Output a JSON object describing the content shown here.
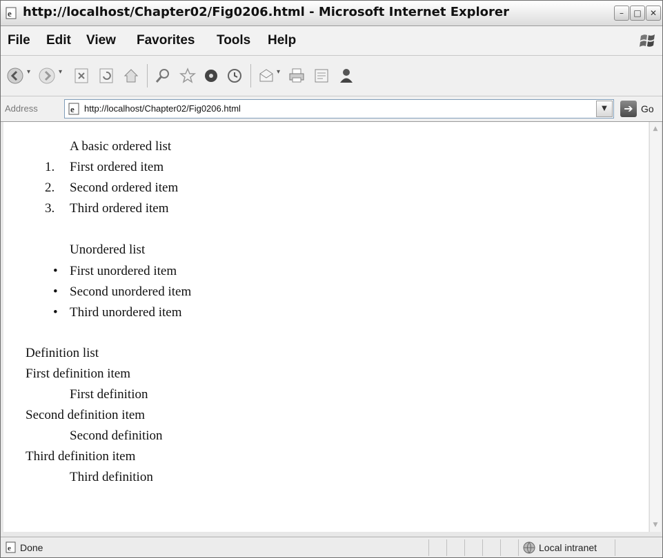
{
  "window": {
    "title": "http://localhost/Chapter02/Fig0206.html - Microsoft Internet Explorer"
  },
  "menu": {
    "items": [
      "File",
      "Edit",
      "View",
      "Favorites",
      "Tools",
      "Help"
    ]
  },
  "toolbar": {
    "icons": [
      "back-icon",
      "forward-icon",
      "stop-icon",
      "refresh-icon",
      "home-icon",
      "search-icon",
      "favorites-icon",
      "media-icon",
      "history-icon",
      "mail-icon",
      "print-icon",
      "edit-icon",
      "messenger-icon"
    ]
  },
  "address": {
    "label": "Address",
    "url": "http://localhost/Chapter02/Fig0206.html",
    "go_label": "Go"
  },
  "content": {
    "ordered_caption": "A basic ordered list",
    "ordered_items": [
      "First ordered item",
      "Second ordered item",
      "Third ordered item"
    ],
    "ordered_markers": [
      "1.",
      "2.",
      "3."
    ],
    "unordered_caption": "Unordered list",
    "unordered_items": [
      "First unordered item",
      "Second unordered item",
      "Third unordered item"
    ],
    "definition_caption": "Definition list",
    "definitions": [
      {
        "term": "First definition item",
        "definition": "First definition"
      },
      {
        "term": "Second definition item",
        "definition": "Second definition"
      },
      {
        "term": "Third definition item",
        "definition": "Third definition"
      }
    ]
  },
  "status": {
    "text": "Done",
    "zone": "Local intranet"
  }
}
